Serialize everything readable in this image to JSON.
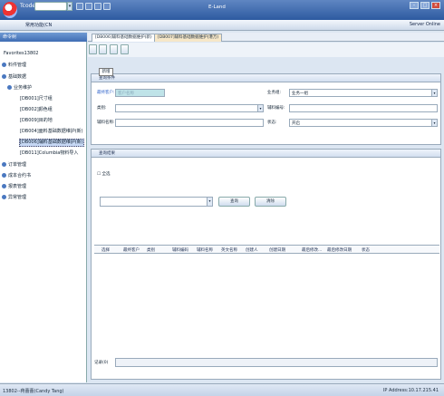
{
  "titlebar": {
    "tcode_label": "Tcode",
    "app_title": "E-Land"
  },
  "menubar": {
    "favorites_menu": "常用功能(CN",
    "server": "Server Online"
  },
  "left_panel": {
    "header": "命令树",
    "items": [
      {
        "label": "Favorites13802",
        "type": "root"
      },
      {
        "label": "料件管理",
        "type": "group"
      },
      {
        "label": "基础数据",
        "type": "group"
      },
      {
        "label": "业务维护",
        "type": "group"
      },
      {
        "label": "[DB001]尺寸组",
        "type": "leaf"
      },
      {
        "label": "[DB002]颜色组",
        "type": "leaf"
      },
      {
        "label": "[DB009]目的地",
        "type": "leaf"
      },
      {
        "label": "[DB004]面料基础数据维护(新)",
        "type": "leaf"
      },
      {
        "label": "[DB006]辅料基础数据维护(新)",
        "type": "leaf-selected"
      },
      {
        "label": "[DB011]Columbia物料导入",
        "type": "leaf"
      },
      {
        "label": "订单管理",
        "type": "group"
      },
      {
        "label": "成本合约书",
        "type": "group"
      },
      {
        "label": "报表管理",
        "type": "group"
      },
      {
        "label": "异常管理",
        "type": "group"
      }
    ]
  },
  "tabs": [
    {
      "label": "[DB006]辅料基础数据维护(新)"
    },
    {
      "label": "[DB007]辅料基础数据维护(港万)"
    }
  ],
  "toolbar": {
    "tooltip": "新增"
  },
  "criteria": {
    "header": "查询条件",
    "supplier_label": "最终客户:",
    "supplier_placeholder": "客户名称",
    "category_label": "类别:",
    "name_label": "辅料名称:",
    "business_label": "业务组:",
    "business_value": "业务一组",
    "code_label": "辅料编号:",
    "status_label": "状态:",
    "status_value": "开启"
  },
  "results": {
    "header": "查询结果",
    "select_all": "全选",
    "search_btn": "查询",
    "clear_btn": "清除",
    "columns": [
      "选择",
      "最终客户",
      "类别",
      "辅料编码",
      "辅料名称",
      "英文名称",
      "创建人",
      "创建日期",
      "最后修改...",
      "最后修改日期",
      "状态"
    ],
    "record_count": "记录(0)"
  },
  "statusbar": {
    "user": "13802--蒋蕾蕾(Candy Tang)",
    "ip": "IP Address:10.17.215.41"
  }
}
